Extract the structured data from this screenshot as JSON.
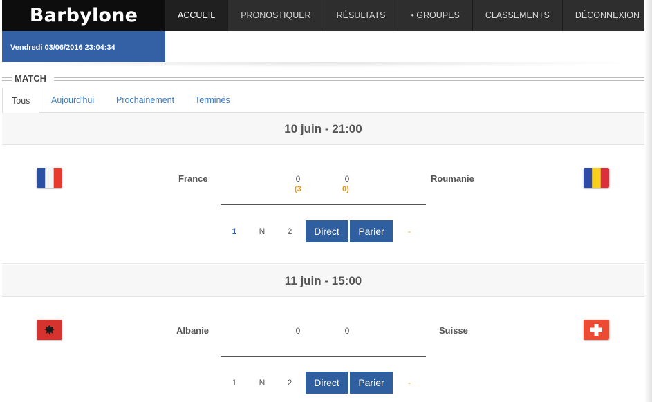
{
  "app": {
    "brand": "Barbylone",
    "datetime": "Vendredi 03/06/2016 23:04:34"
  },
  "nav": {
    "items": [
      {
        "label": "ACCUEIL",
        "active": true
      },
      {
        "label": "PRONOSTIQUER",
        "active": false
      },
      {
        "label": "RÉSULTATS",
        "active": false
      },
      {
        "label": "• GROUPES",
        "active": false
      },
      {
        "label": "CLASSEMENTS",
        "active": false
      },
      {
        "label": "DÉCONNEXION",
        "active": false
      }
    ]
  },
  "section": {
    "title": "MATCH"
  },
  "tabs": [
    {
      "label": "Tous",
      "active": true
    },
    {
      "label": "Aujourd'hui",
      "active": false
    },
    {
      "label": "Prochainement",
      "active": false
    },
    {
      "label": "Terminés",
      "active": false
    }
  ],
  "matches": [
    {
      "datetime": "10 juin - 21:00",
      "home": {
        "name": "France",
        "flag": "france-flag-icon",
        "score": "0",
        "pscore": "(3"
      },
      "away": {
        "name": "Roumanie",
        "flag": "romania-flag-icon",
        "score": "0",
        "pscore": "0)"
      },
      "odds": [
        "1",
        "N",
        "2"
      ],
      "selected_odd": "1",
      "direct_label": "Direct",
      "bet_label": "Parier",
      "dash": "-"
    },
    {
      "datetime": "11 juin - 15:00",
      "home": {
        "name": "Albanie",
        "flag": "albania-flag-icon",
        "score": "0",
        "pscore": ""
      },
      "away": {
        "name": "Suisse",
        "flag": "switzerland-flag-icon",
        "score": "0",
        "pscore": ""
      },
      "odds": [
        "1",
        "N",
        "2"
      ],
      "selected_odd": "",
      "direct_label": "Direct",
      "bet_label": "Parier",
      "dash": "-"
    }
  ],
  "colors": {
    "brand_bg": "#0d0d0d",
    "nav_bg": "#2e2e2e",
    "date_bg": "#3461a5",
    "button_bg": "#2f5f9e",
    "link": "#3a7bc4",
    "accent_orange": "#e59a14"
  }
}
